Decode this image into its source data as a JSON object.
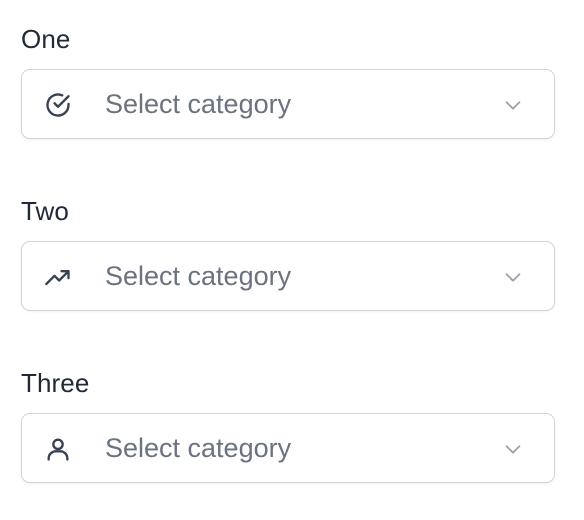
{
  "fields": [
    {
      "label": "One",
      "placeholder": "Select category",
      "icon": "check-circle-icon"
    },
    {
      "label": "Two",
      "placeholder": "Select category",
      "icon": "trending-up-icon"
    },
    {
      "label": "Three",
      "placeholder": "Select category",
      "icon": "user-icon"
    }
  ],
  "colors": {
    "label": "#1f2937",
    "placeholder": "#6b7280",
    "border": "#d1d5db",
    "icon": "#374151",
    "chevron": "#9ca3af"
  }
}
